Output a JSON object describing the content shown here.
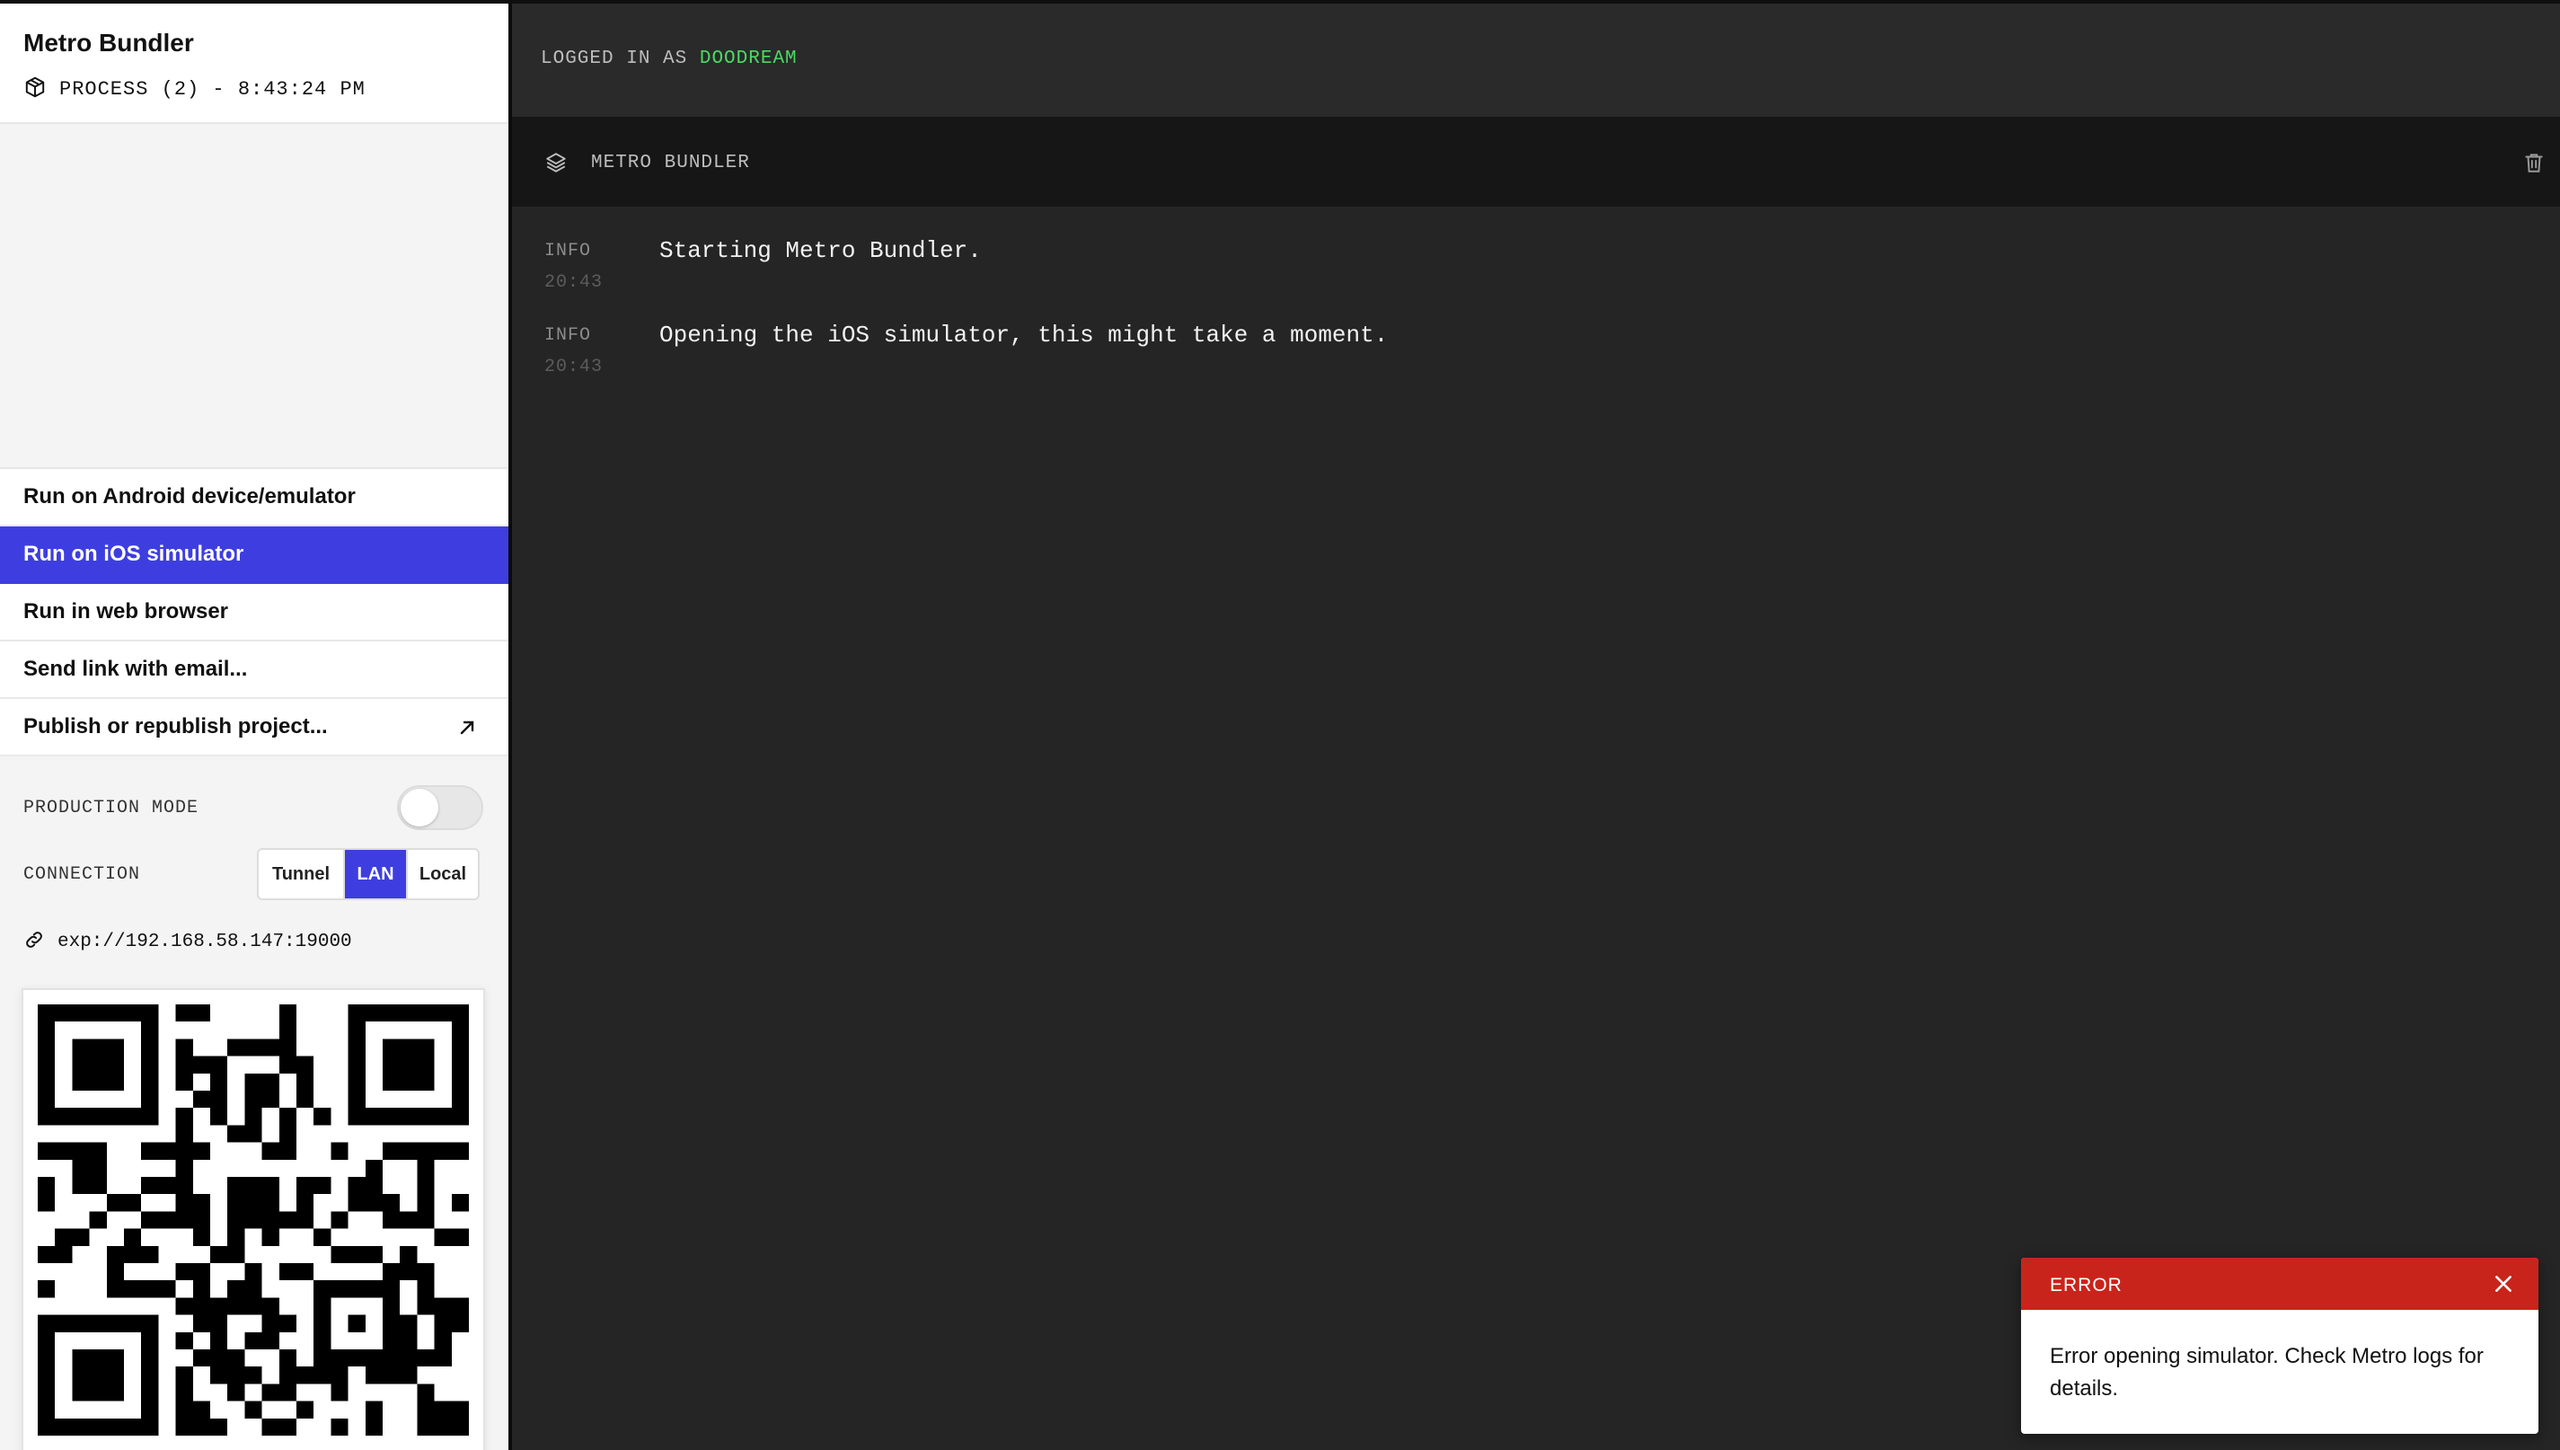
{
  "sidebar": {
    "title": "Metro Bundler",
    "process_text": "PROCESS (2) - 8:43:24 PM",
    "menu": [
      {
        "label": "Run on Android device/emulator"
      },
      {
        "label": "Run on iOS simulator"
      },
      {
        "label": "Run in web browser"
      },
      {
        "label": "Send link with email..."
      },
      {
        "label": "Publish or republish project..."
      }
    ],
    "active_menu_index": 1,
    "production_mode_label": "PRODUCTION MODE",
    "production_mode_on": false,
    "connection_label": "CONNECTION",
    "connection_options": [
      "Tunnel",
      "LAN",
      "Local"
    ],
    "connection_selected": "LAN",
    "url": "exp://192.168.58.147:19000"
  },
  "main": {
    "login_prefix": "LOGGED IN AS",
    "username": "DOODREAM",
    "panel_title": "METRO BUNDLER",
    "logs": [
      {
        "level": "INFO",
        "time": "20:43",
        "message": "Starting Metro Bundler."
      },
      {
        "level": "INFO",
        "time": "20:43",
        "message": "Opening the iOS simulator, this might take a moment."
      }
    ]
  },
  "toast": {
    "title": "ERROR",
    "message": "Error opening simulator. Check Metro logs for details."
  },
  "colors": {
    "accent": "#3e3ee0",
    "username": "#4cd964",
    "error": "#c8241b"
  }
}
